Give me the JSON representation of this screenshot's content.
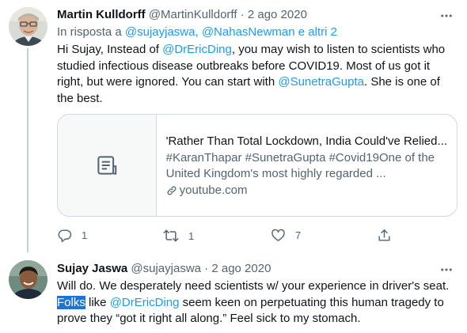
{
  "tweet1": {
    "display_name": "Martin Kulldorff",
    "handle": "@MartinKulldorff",
    "separator": " · ",
    "date": "2 ago 2020",
    "reply_prefix": "In risposta a ",
    "reply_handle1": "@sujayjaswa",
    "reply_comma": ", ",
    "reply_handle2": "@NahasNewman",
    "reply_suffix": " e altri 2",
    "text_part1": "Hi Sujay, Instead of ",
    "mention1": "@DrEricDing",
    "text_part2": ", you may wish to listen to scientists who studied infectious disease outbreaks before COVID19. Most of us got it right, but were ignored. You can start with ",
    "mention2": "@SunetraGupta",
    "text_part3": ". She is one of the best.",
    "card": {
      "title": "'Rather Than Total Lockdown, India Could've Relied...",
      "description": "#KaranThapar #SunetraGupta #Covid19One of the United Kingdom's most highly regarded ...",
      "domain": "youtube.com"
    },
    "counts": {
      "reply": "1",
      "retweet": "1",
      "like": "7"
    }
  },
  "tweet2": {
    "display_name": "Sujay Jaswa",
    "handle": "@sujayjaswa",
    "separator": " · ",
    "date": "2 ago 2020",
    "text_part1": "Will do. We desperately need scientists w/ your experience in driver's seat. ",
    "highlighted": "Folks",
    "text_part2": " like ",
    "mention1": "@DrEricDing",
    "text_part3": " seem keen on perpetuating this human tragedy to prove they “got it right all along.” Feel sick to my stomach."
  },
  "colors": {
    "accent": "#1d9bf0",
    "muted": "#536471",
    "text": "#0f1419",
    "selection": "#1e74d6"
  }
}
